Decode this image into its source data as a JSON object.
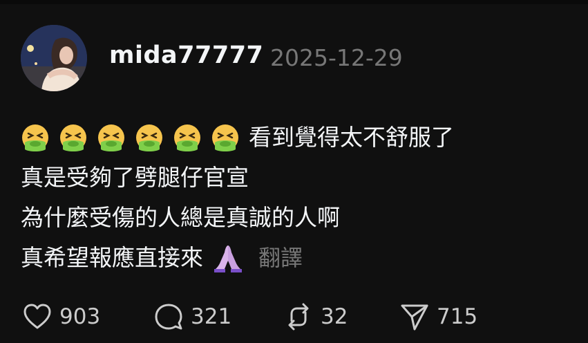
{
  "post": {
    "username": "mida77777",
    "date": "2025-12-29",
    "lines": [
      "看到覺得太不舒服了",
      "真是受夠了劈腿仔官宣",
      "為什麼受傷的人總是真誠的人啊",
      "真希望報應直接來"
    ],
    "translate_label": "翻譯",
    "emoji_first_line": [
      "nauseated-face-emoji",
      "nauseated-face-emoji",
      "nauseated-face-emoji",
      "nauseated-face-emoji",
      "nauseated-face-emoji",
      "nauseated-face-emoji"
    ],
    "emoji_last_line": "folded-hands-emoji"
  },
  "actions": {
    "like_count": "903",
    "reply_count": "321",
    "repost_count": "32",
    "share_count": "715",
    "icons": [
      "heart-icon",
      "comment-icon",
      "repost-icon",
      "send-icon"
    ]
  },
  "colors": {
    "background": "#101010",
    "text": "#f3f5f7",
    "muted": "#777777"
  }
}
